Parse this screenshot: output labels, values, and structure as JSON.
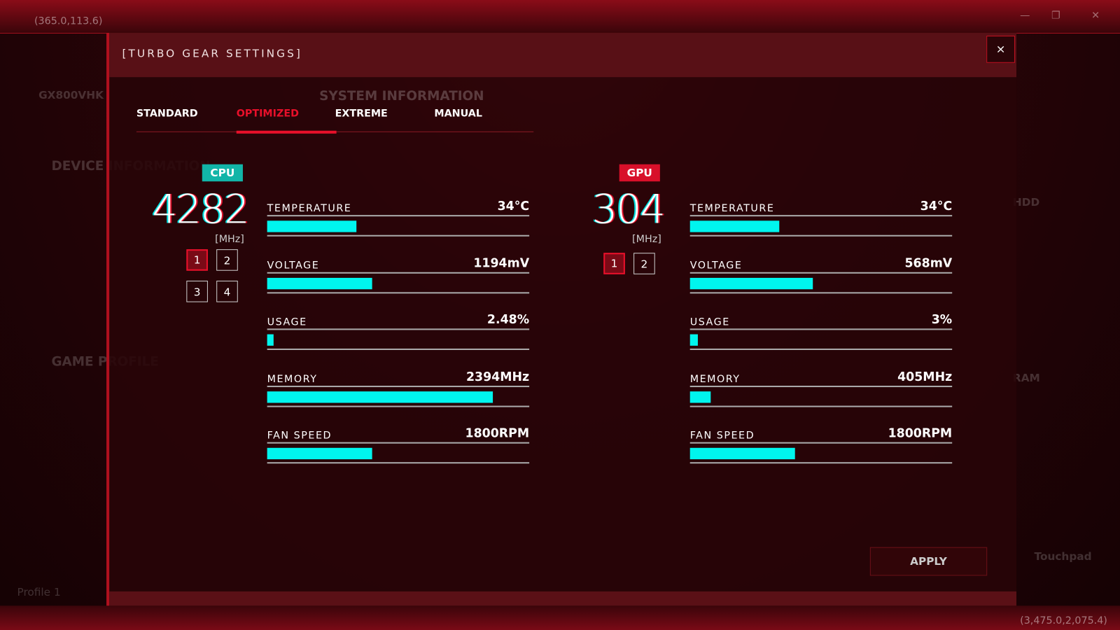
{
  "background": {
    "coord_top": "(365.0,113.6)",
    "coord_bottom": "(3,475.0,2,075.4)",
    "model": "GX800VHK",
    "device_info": "DEVICE INFORMATION",
    "game_profile": "GAME PROFILE",
    "system_info": "SYSTEM INFORMATION",
    "hdd": "HDD",
    "ram": "RAM",
    "touchpad": "Touchpad",
    "profile": "Profile 1"
  },
  "dialog": {
    "title": "[TURBO GEAR SETTINGS]",
    "close_label": "×",
    "tabs": [
      {
        "label": "STANDARD"
      },
      {
        "label": "OPTIMIZED",
        "active": true
      },
      {
        "label": "EXTREME"
      },
      {
        "label": "MANUAL"
      }
    ],
    "apply_label": "APPLY"
  },
  "cpu": {
    "badge": "CPU",
    "badge_color": "#12b5a8",
    "clock": "4282",
    "unit": "[MHz]",
    "cores": [
      "1",
      "2",
      "3",
      "4"
    ],
    "selected_core": "1",
    "metrics": [
      {
        "label": "TEMPERATURE",
        "value": "34°C",
        "level": 0.34
      },
      {
        "label": "VOLTAGE",
        "value": "1194mV",
        "level": 0.4
      },
      {
        "label": "USAGE",
        "value": "2.48%",
        "level": 0.025
      },
      {
        "label": "MEMORY",
        "value": "2394MHz",
        "level": 0.86
      },
      {
        "label": "FAN SPEED",
        "value": "1800RPM",
        "level": 0.4
      }
    ]
  },
  "gpu": {
    "badge": "GPU",
    "badge_color": "#d8102a",
    "clock": "304",
    "unit": "[MHz]",
    "cores": [
      "1",
      "2"
    ],
    "selected_core": "1",
    "metrics": [
      {
        "label": "TEMPERATURE",
        "value": "34°C",
        "level": 0.34
      },
      {
        "label": "VOLTAGE",
        "value": "568mV",
        "level": 0.47
      },
      {
        "label": "USAGE",
        "value": "3%",
        "level": 0.03
      },
      {
        "label": "MEMORY",
        "value": "405MHz",
        "level": 0.08
      },
      {
        "label": "FAN SPEED",
        "value": "1800RPM",
        "level": 0.4
      }
    ]
  },
  "accent": "#e8102a",
  "bar_color": "#00f5ee"
}
